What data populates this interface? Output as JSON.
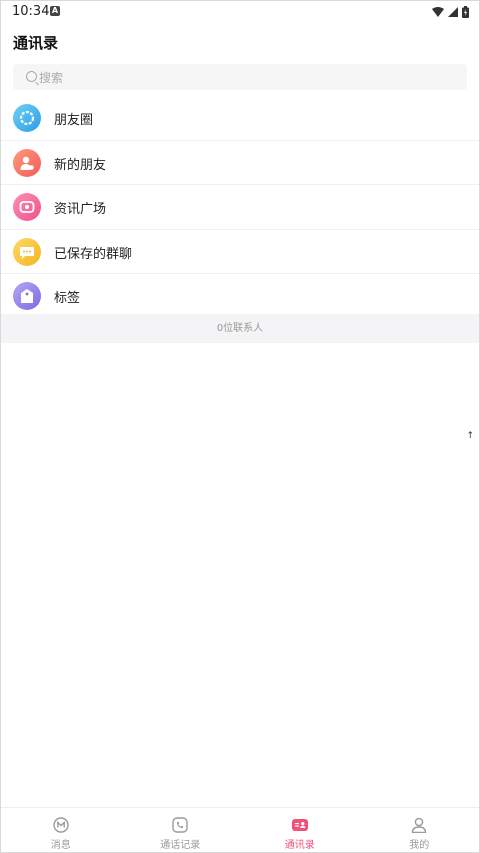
{
  "status_bar": {
    "time": "10:34",
    "notification_badge": "A"
  },
  "header": {
    "title": "通讯录"
  },
  "search": {
    "placeholder": "搜索"
  },
  "menu": [
    {
      "label": "朋友圈",
      "icon": "moments-icon",
      "color": "#3aa8ec"
    },
    {
      "label": "新的朋友",
      "icon": "new-friend-icon",
      "color": "#f46a62"
    },
    {
      "label": "资讯广场",
      "icon": "news-plaza-icon",
      "color": "#f25e93"
    },
    {
      "label": "已保存的群聊",
      "icon": "saved-groups-icon",
      "color": "#f7bf2e"
    },
    {
      "label": "标签",
      "icon": "tag-icon",
      "color": "#8e7aea"
    }
  ],
  "contacts": {
    "count_text": "0位联系人"
  },
  "bottom_nav": {
    "items": [
      {
        "label": "消息",
        "icon": "message-icon",
        "active": false
      },
      {
        "label": "通话记录",
        "icon": "call-log-icon",
        "active": false
      },
      {
        "label": "通讯录",
        "icon": "contacts-icon",
        "active": true
      },
      {
        "label": "我的",
        "icon": "profile-icon",
        "active": false
      }
    ],
    "active_color": "#f0507a"
  }
}
